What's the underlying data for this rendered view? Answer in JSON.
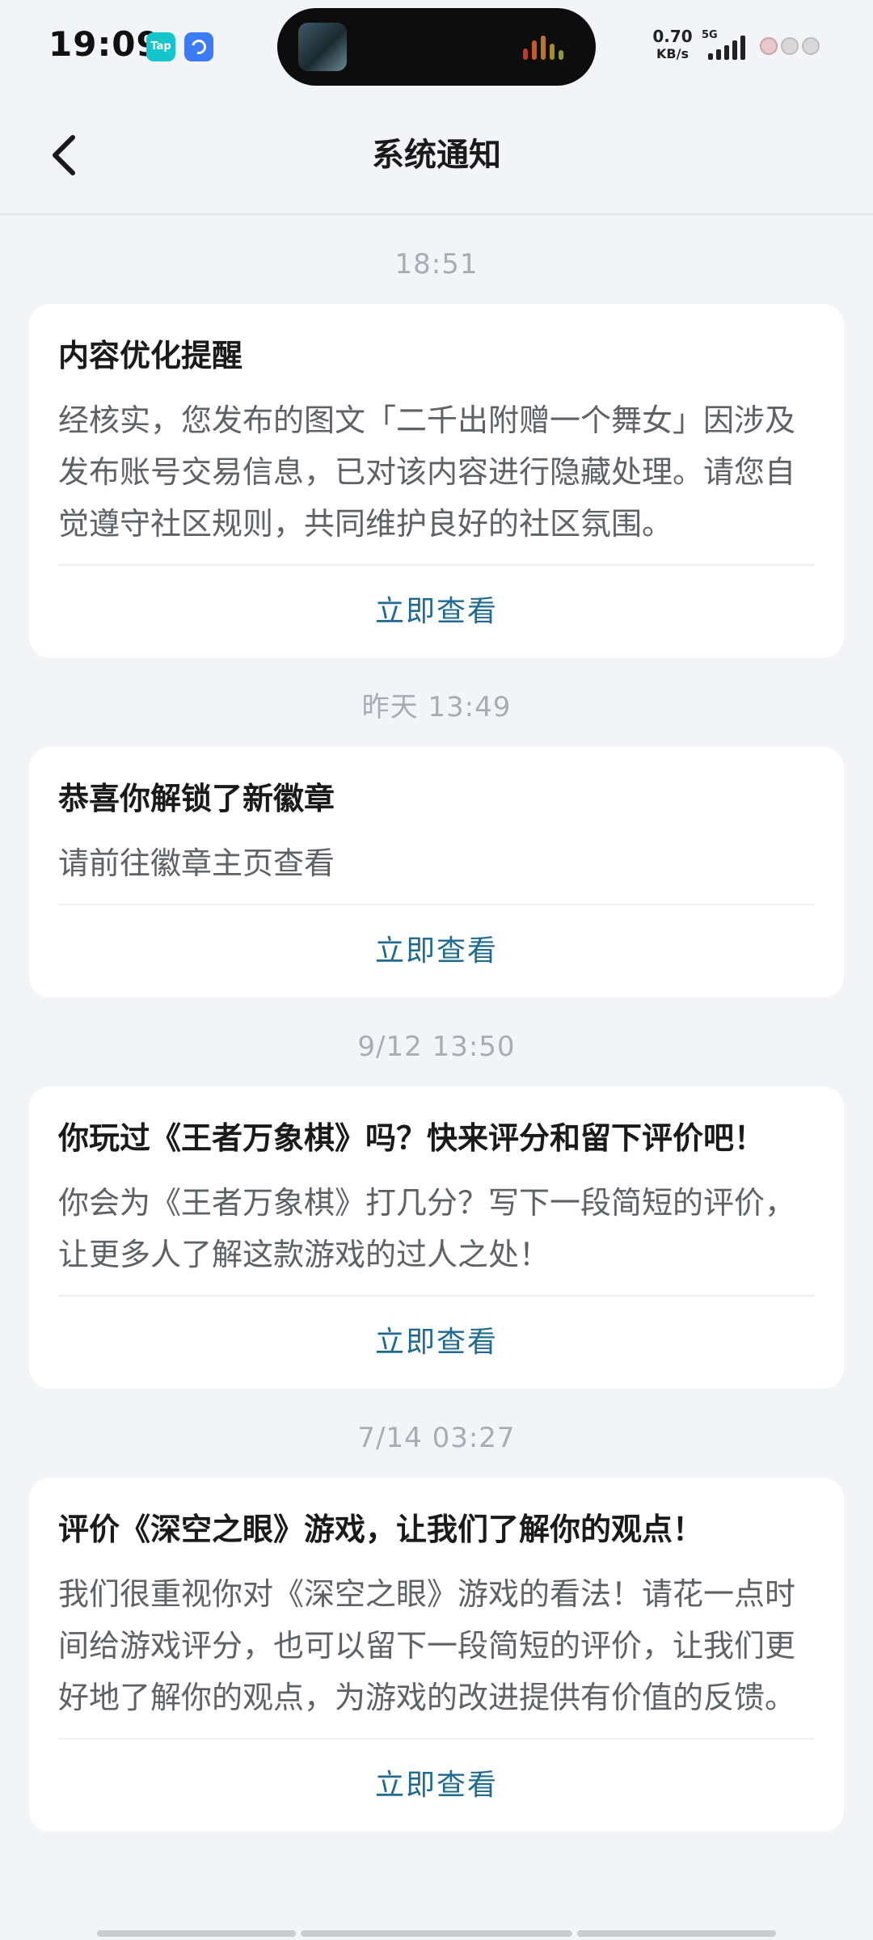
{
  "status_bar": {
    "time": "19:09",
    "taptap_icon_label": "Tap",
    "net_speed_value": "0.70",
    "net_speed_unit": "KB/s",
    "network_type": "5G"
  },
  "header": {
    "title": "系统通知"
  },
  "notifications": [
    {
      "timestamp": "18:51",
      "title": "内容优化提醒",
      "body": "经核实，您发布的图文「二千出附赠一个舞女」因涉及发布账号交易信息，已对该内容进行隐藏处理。请您自觉遵守社区规则，共同维护良好的社区氛围。",
      "action": "立即查看"
    },
    {
      "timestamp": "昨天  13:49",
      "title": "恭喜你解锁了新徽章",
      "body": "请前往徽章主页查看",
      "action": "立即查看"
    },
    {
      "timestamp": "9/12  13:50",
      "title": "你玩过《王者万象棋》吗？快来评分和留下评价吧！",
      "body": "你会为《王者万象棋》打几分？写下一段简短的评价，让更多人了解这款游戏的过人之处！",
      "action": "立即查看"
    },
    {
      "timestamp": "7/14  03:27",
      "title": "评价《深空之眼》游戏，让我们了解你的观点！",
      "body": "我们很重视你对《深空之眼》游戏的看法！请花一点时间给游戏评分，也可以留下一段简短的评价，让我们更好地了解你的观点，为游戏的改进提供有价值的反馈。",
      "action": "立即查看"
    }
  ],
  "colors": {
    "background": "#f2f4f7",
    "card": "#ffffff",
    "action_link": "#1e6a93",
    "timestamp": "#a8adb3",
    "body_text": "#5e6166"
  },
  "icons": {
    "back": "chevron-left-icon",
    "island": "now-playing-artwork",
    "signal": "signal-bars-icon",
    "battery": "battery-icon"
  }
}
